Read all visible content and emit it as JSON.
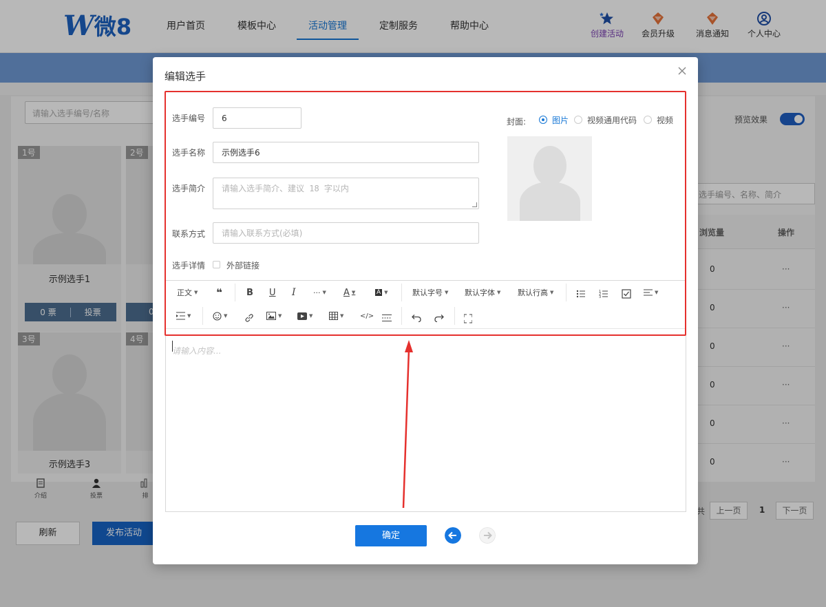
{
  "nav": {
    "logo_text": "微8",
    "items": [
      "用户首页",
      "模板中心",
      "活动管理",
      "定制服务",
      "帮助中心"
    ],
    "actions": [
      "创建活动",
      "会员升级",
      "消息通知",
      "个人中心"
    ]
  },
  "background": {
    "search_placeholder": "请输入选手编号/名称",
    "players": [
      {
        "num": "1号",
        "name": "示例选手1"
      },
      {
        "num": "2号",
        "name": ""
      },
      {
        "num": "3号",
        "name": "示例选手3"
      },
      {
        "num": "4号",
        "name": ""
      }
    ],
    "vote_count": "0 票",
    "vote_label": "投票",
    "vote_count_2": "0",
    "tabs": [
      "介绍",
      "投票",
      "排"
    ],
    "refresh": "刷新",
    "publish": "发布活动",
    "preview_label": "预览效果",
    "right_search_placeholder": "选手编号、名称、简介",
    "table_headers": [
      "浏览量",
      "操作"
    ],
    "rows": [
      "0",
      "0",
      "0",
      "0",
      "0",
      "0"
    ],
    "row_action": "···",
    "pager": {
      "prev": "上一页",
      "page": "1",
      "next": "下一页",
      "prefix": "共"
    }
  },
  "modal": {
    "title": "编辑选手",
    "fields": {
      "number": {
        "label": "选手编号",
        "value": "6"
      },
      "name": {
        "label": "选手名称",
        "value": "示例选手6"
      },
      "intro": {
        "label": "选手简介",
        "placeholder": "请输入选手简介、建议 18 字以内"
      },
      "contact": {
        "label": "联系方式",
        "placeholder": "请输入联系方式(必填)"
      },
      "detail": {
        "label": "选手详情",
        "checkbox_label": "外部链接"
      }
    },
    "cover": {
      "label": "封面:",
      "options": [
        "图片",
        "视频通用代码",
        "视频"
      ],
      "selected": "图片"
    },
    "toolbar": {
      "paragraph": "正文",
      "font_size": "默认字号",
      "font_family": "默认字体",
      "line_height": "默认行高"
    },
    "editor_placeholder": "请输入内容...",
    "confirm": "确定"
  }
}
